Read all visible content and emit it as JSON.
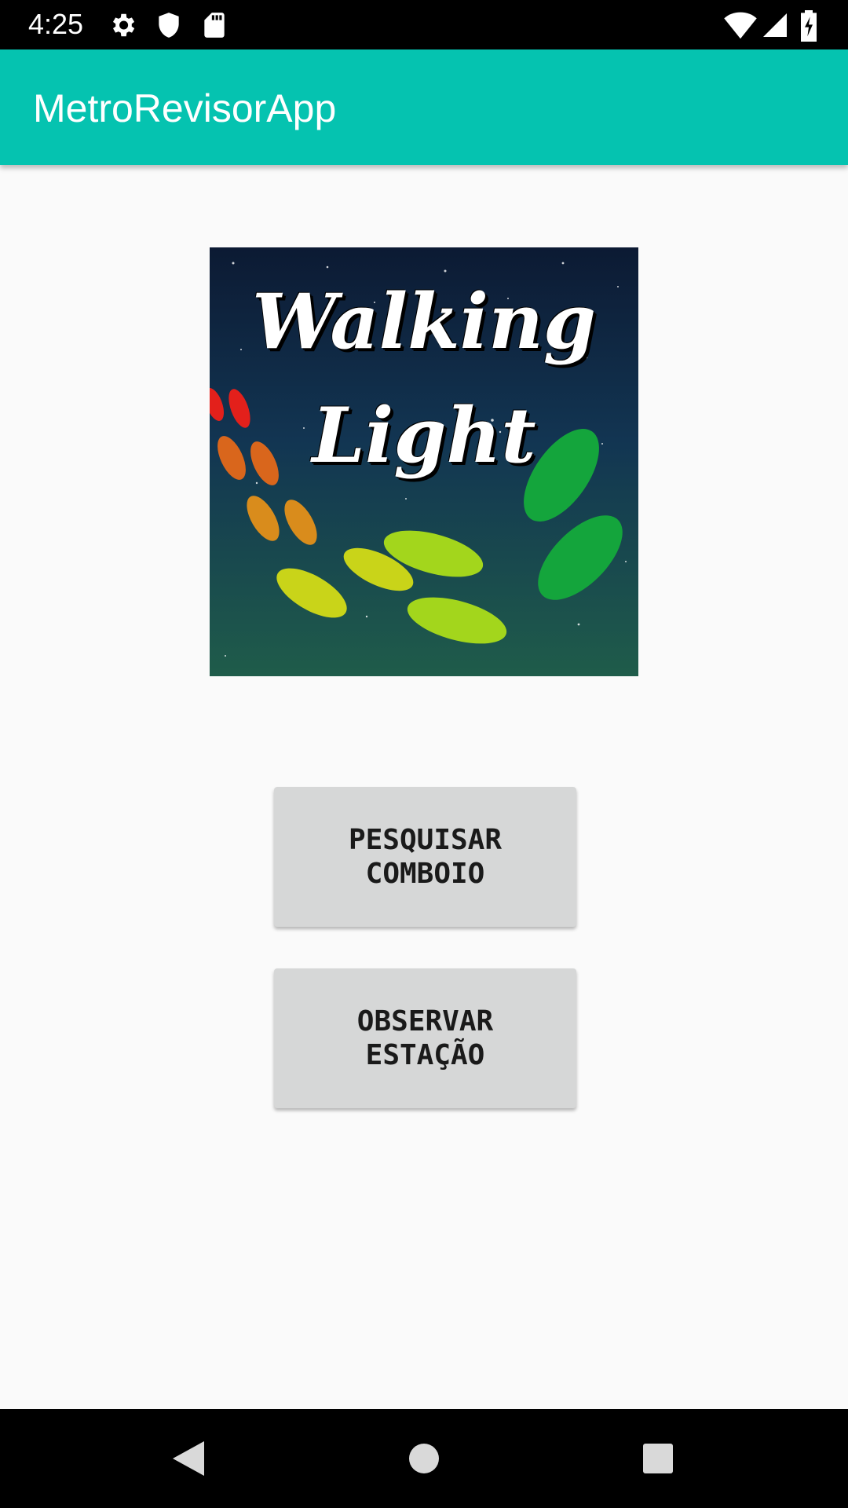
{
  "status_bar": {
    "time": "4:25",
    "icons": [
      "gear-icon",
      "shield-icon",
      "sd-card-icon",
      "wifi-icon",
      "cell-signal-icon",
      "battery-charging-icon"
    ]
  },
  "app_bar": {
    "title": "MetroRevisorApp",
    "color": "#05c3b0"
  },
  "logo": {
    "line1": "Walking",
    "line2": "Light"
  },
  "buttons": {
    "search_train": "PESQUISAR\nCOMBOIO",
    "observe_station": "OBSERVAR\nESTAÇÃO"
  },
  "nav_bar": {
    "icons": [
      "back-icon",
      "home-icon",
      "recents-icon"
    ]
  }
}
